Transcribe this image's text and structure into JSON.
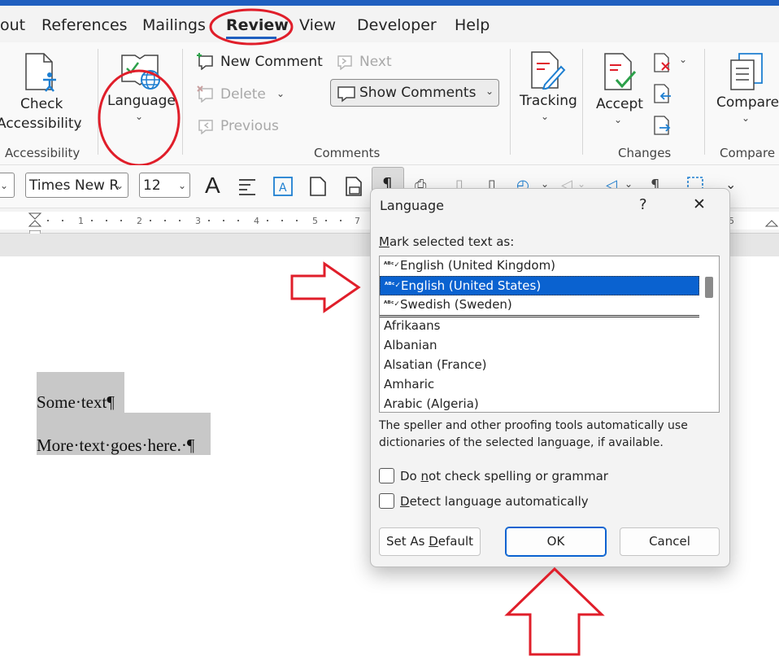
{
  "tabs": [
    "out",
    "References",
    "Mailings",
    "Review",
    "View",
    "Developer",
    "Help"
  ],
  "ribbon": {
    "check_accessibility": [
      "Check",
      "Accessibility"
    ],
    "language": "Language",
    "new_comment": "New Comment",
    "delete": "Delete",
    "previous": "Previous",
    "next": "Next",
    "show_comments": "Show Comments",
    "tracking": "Tracking",
    "accept": "Accept",
    "compare": "Compare",
    "groups": {
      "accessibility": "Accessibility",
      "comments": "Comments",
      "changes": "Changes",
      "compare": "Compare"
    }
  },
  "format_bar": {
    "font_name": "Times New R",
    "font_size": "12"
  },
  "document": {
    "lines": [
      "Some·text¶",
      "More·text·goes·here.·¶"
    ]
  },
  "dialog": {
    "title": "Language",
    "help": "?",
    "close": "✕",
    "mark_label_first": "M",
    "mark_label_rest": "ark selected text as:",
    "languages": [
      "English (United Kingdom)",
      "English (United States)",
      "Swedish (Sweden)",
      "Afrikaans",
      "Albanian",
      "Alsatian (France)",
      "Amharic",
      "Arabic (Algeria)"
    ],
    "selected_index": 1,
    "description": [
      "The speller and other proofing tools automatically use",
      "dictionaries of the selected language, if available."
    ],
    "checkbox_no_check": {
      "pre": "Do ",
      "u": "n",
      "post": "ot check spelling or grammar"
    },
    "checkbox_detect": {
      "pre": "",
      "u": "D",
      "post": "etect language automatically"
    },
    "btn_default": {
      "pre": "Set As ",
      "u": "D",
      "post": "efault"
    },
    "btn_ok": "OK",
    "btn_cancel": "Cancel"
  },
  "colors": {
    "accent": "#1f5fbf",
    "selection": "#0a62d0",
    "annotation": "#e01e2a"
  }
}
